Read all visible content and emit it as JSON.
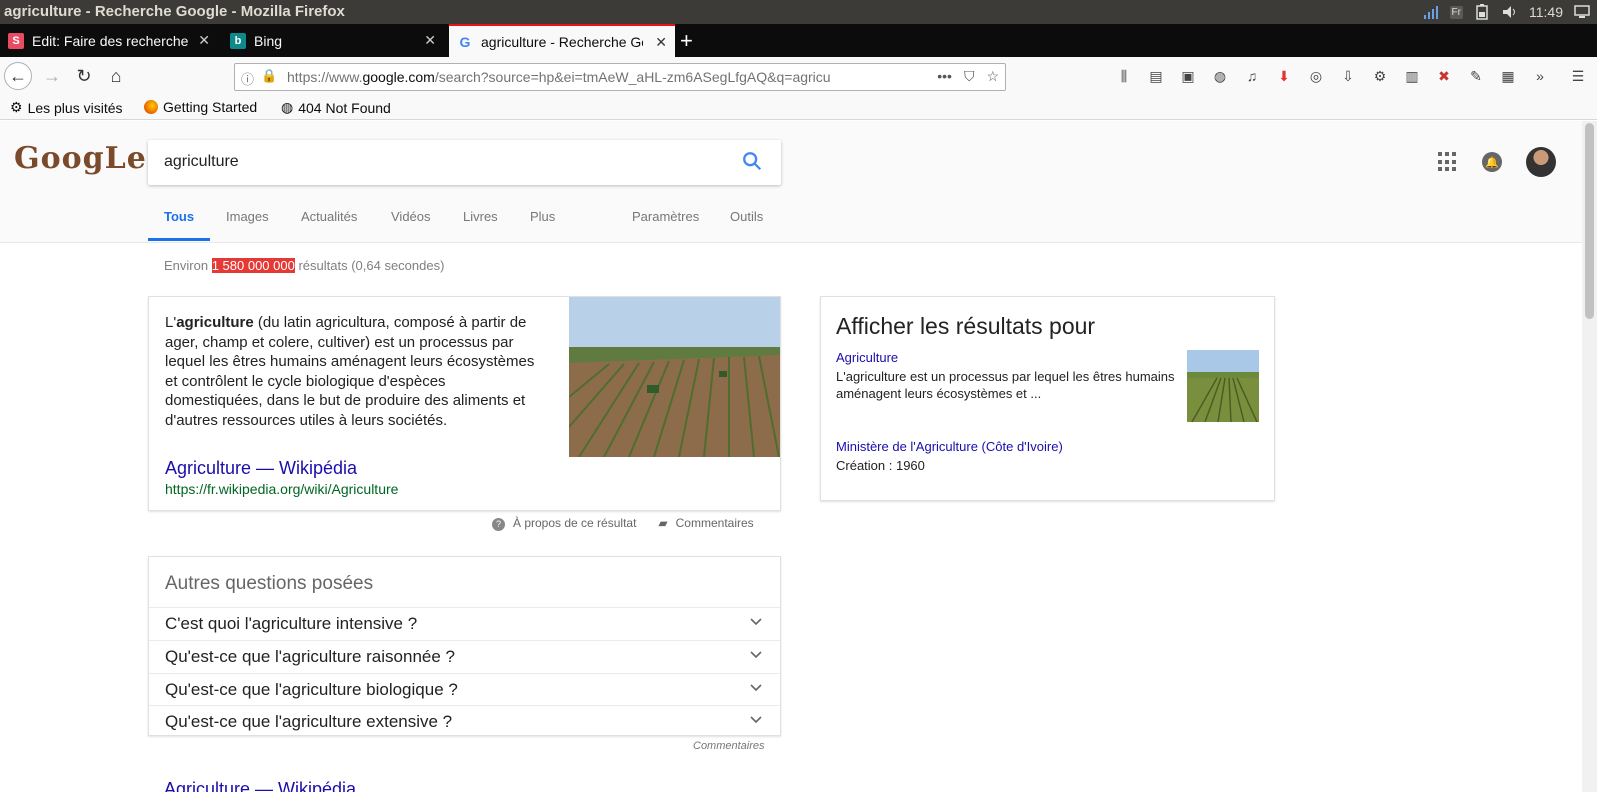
{
  "window": {
    "title": "agriculture - Recherche Google - Mozilla Firefox",
    "clock": "11:49",
    "keyboard": "Fr"
  },
  "tabs": [
    {
      "label": "Edit: Faire des recherche",
      "favicon": "S",
      "favicon_color": "#e84c62"
    },
    {
      "label": "Bing",
      "favicon": "b",
      "favicon_color": "#0e8a8a"
    },
    {
      "label": "agriculture - Recherche Google",
      "favicon": "G",
      "favicon_color": "#4285f4"
    }
  ],
  "urlbar": {
    "url_prefix": "https://www.",
    "url_domain": "google.com",
    "url_rest": "/search?source=hp&ei=tmAeW_aHL-zm6ASegLfgAQ&q=agricu"
  },
  "bookmarks": [
    {
      "label": "Les plus visités",
      "icon": "gear-icon"
    },
    {
      "label": "Getting Started",
      "icon": "firefox-icon"
    },
    {
      "label": "404 Not Found",
      "icon": "globe-icon"
    }
  ],
  "google": {
    "logo": "GoogLe",
    "query": "agriculture",
    "tabs": [
      "Tous",
      "Images",
      "Actualités",
      "Vidéos",
      "Livres",
      "Plus",
      "Paramètres",
      "Outils"
    ],
    "stats": {
      "prefix": "Environ ",
      "count": "1 580 000 000",
      "suffix": " résultats (0,64 secondes)"
    }
  },
  "snippet": {
    "lead": "L'",
    "bold": "agriculture",
    "text": " (du latin agricultura, composé à partir de ager, champ et colere, cultiver) est un processus par lequel les êtres humains aménagent leurs écosystèmes et contrôlent le cycle biologique d'espèces domestiquées, dans le but de produire des aliments et d'autres ressources utiles à leurs sociétés.",
    "link": "Agriculture — Wikipédia",
    "cite": "https://fr.wikipedia.org/wiki/Agriculture",
    "about": "À propos de ce résultat",
    "feedback": "Commentaires"
  },
  "paa": {
    "title": "Autres questions posées",
    "questions": [
      "C'est quoi l'agriculture intensive ?",
      "Qu'est-ce que l'agriculture raisonnée ?",
      "Qu'est-ce que l'agriculture biologique ?",
      "Qu'est-ce que l'agriculture extensive ?"
    ],
    "feedback": "Commentaires"
  },
  "knowledge": {
    "title": "Afficher les résultats pour",
    "item1_link": "Agriculture",
    "item1_desc": "L'agriculture est un processus par lequel les êtres humains aménagent leurs écosystèmes et ...",
    "item2_link": "Ministère de l'Agriculture (Côte d'Ivoire)",
    "item2_meta": "Création : 1960"
  },
  "next_result_link": "Agriculture — Wikipédia"
}
